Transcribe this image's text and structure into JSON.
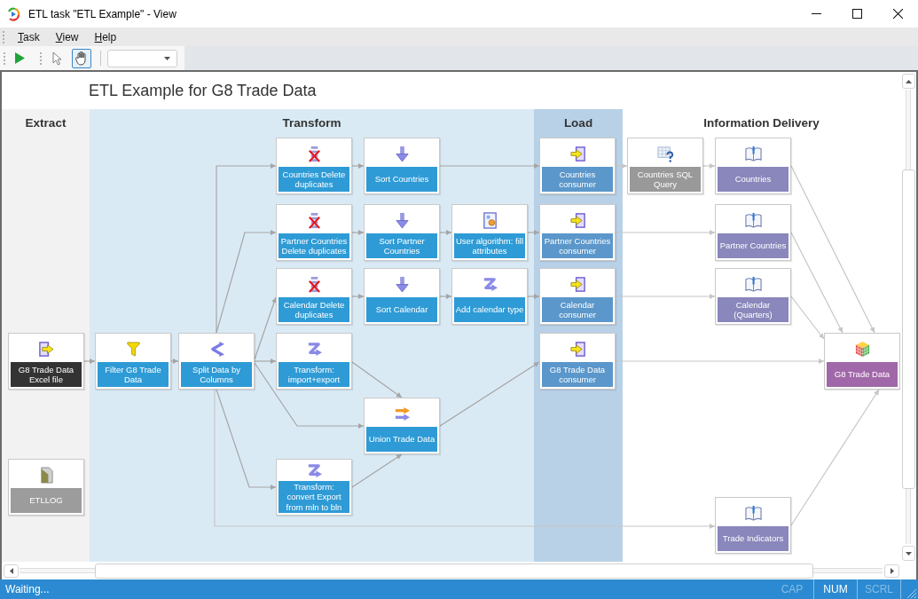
{
  "window": {
    "title": "ETL task \"ETL Example\" - View"
  },
  "menu": [
    "Task",
    "View",
    "Help"
  ],
  "toolbar": {
    "tools": [
      {
        "kind": "pointer",
        "selected": false
      },
      {
        "kind": "hand",
        "selected": true
      }
    ]
  },
  "diagram": {
    "title": "ETL Example for G8 Trade Data",
    "lanes": [
      {
        "title": "Extract",
        "color": "#f2f2f2",
        "nodes": [
          {
            "label": "G8 Trade Data Excel file",
            "kind": "source"
          },
          {
            "label": "ETLLOG",
            "kind": "log"
          }
        ]
      },
      {
        "title": "Transform",
        "color": "#daeaf5",
        "nodes": [
          {
            "label": "Filter G8 Trade Data",
            "kind": "filter"
          },
          {
            "label": "Split Data by Columns",
            "kind": "split"
          },
          {
            "label": "Countries Delete duplicates",
            "kind": "dedupe"
          },
          {
            "label": "Sort Countries",
            "kind": "sort"
          },
          {
            "label": "Partner Countries Delete duplicates",
            "kind": "dedupe"
          },
          {
            "label": "Sort Partner Countries",
            "kind": "sort"
          },
          {
            "label": "User algorithm: fill attributes",
            "kind": "algorithm"
          },
          {
            "label": "Calendar Delete duplicates",
            "kind": "dedupe"
          },
          {
            "label": "Sort Calendar",
            "kind": "sort"
          },
          {
            "label": "Add calendar type",
            "kind": "transform"
          },
          {
            "label": "Transform: import+export",
            "kind": "transform"
          },
          {
            "label": "Union Trade Data",
            "kind": "union"
          },
          {
            "label": "Transform: convert Export from mln to bln",
            "kind": "transform"
          }
        ]
      },
      {
        "title": "Load",
        "color": "#b8d1e7",
        "nodes": [
          {
            "label": "Countries consumer",
            "kind": "consumer"
          },
          {
            "label": "Partner Countries consumer",
            "kind": "consumer"
          },
          {
            "label": "Calendar consumer",
            "kind": "consumer"
          },
          {
            "label": "G8 Trade Data consumer",
            "kind": "consumer"
          }
        ]
      },
      {
        "title": "Information Delivery",
        "color": "#ffffff",
        "nodes": [
          {
            "label": "Countries SQL Query",
            "kind": "query"
          },
          {
            "label": "Countries",
            "kind": "dimension"
          },
          {
            "label": "Partner Countries",
            "kind": "dimension"
          },
          {
            "label": "Calendar (Quarters)",
            "kind": "dimension"
          },
          {
            "label": "G8 Trade Data",
            "kind": "cube"
          },
          {
            "label": "Trade Indicators",
            "kind": "dimension"
          }
        ]
      }
    ]
  },
  "status_bar": {
    "text": "Waiting...",
    "indicators": [
      {
        "label": "CAP",
        "on": false
      },
      {
        "label": "NUM",
        "on": true
      },
      {
        "label": "SCRL",
        "on": false
      }
    ]
  }
}
